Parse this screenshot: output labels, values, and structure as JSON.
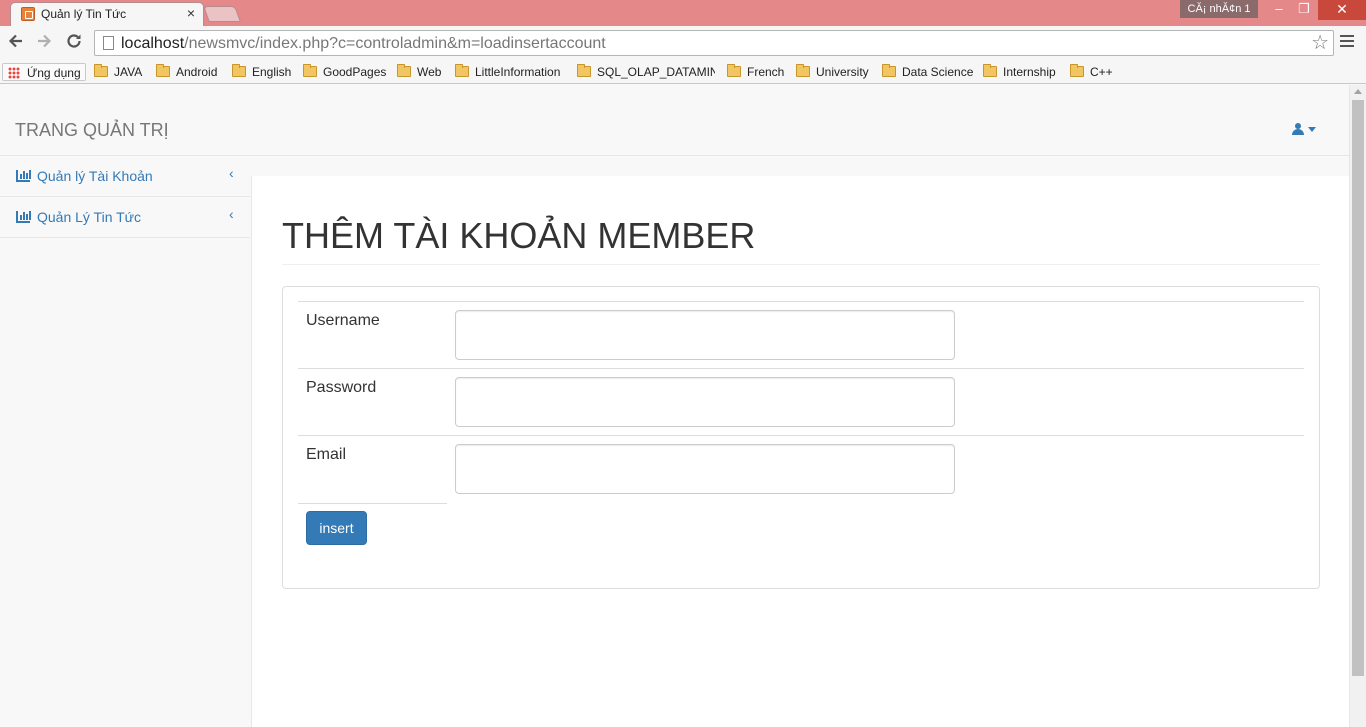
{
  "browser": {
    "tab_title": "Quản lý Tin Tức",
    "tab_close": "×",
    "profile_badge": "CĂ¡ nhĂ¢n 1",
    "window_controls": {
      "minimize": "–",
      "maximize": "❐",
      "close": "✕"
    },
    "url_host": "localhost",
    "url_path": "/newsmvc/index.php?c=controladmin&m=loadinsertaccount",
    "bookmarks": {
      "apps_label": "Ứng dụng",
      "folders": [
        "JAVA",
        "Android",
        "English",
        "GoodPages",
        "Web",
        "LittleInformation",
        "SQL_OLAP_DATAMIN",
        "French",
        "University",
        "Data Science",
        "Internship",
        "C++"
      ]
    }
  },
  "navbar": {
    "brand": "TRANG QUẢN TRỊ"
  },
  "sidebar": {
    "items": [
      {
        "label": "Quản lý Tài Khoản",
        "chevron": "‹"
      },
      {
        "label": "Quản Lý Tin Tức",
        "chevron": "‹"
      }
    ]
  },
  "main": {
    "title": "THÊM TÀI KHOẢN MEMBER",
    "form": {
      "fields": [
        {
          "label": "Username",
          "value": ""
        },
        {
          "label": "Password",
          "value": ""
        },
        {
          "label": "Email",
          "value": ""
        }
      ],
      "submit_label": "insert"
    }
  },
  "colors": {
    "accent": "#337ab7",
    "titlebar": "#e4888a"
  },
  "icons": [
    "close-icon",
    "back-arrow-icon",
    "forward-arrow-icon",
    "reload-icon",
    "page-icon",
    "star-icon",
    "menu-icon",
    "apps-grid-icon",
    "folder-icon",
    "user-icon",
    "caret-down-icon",
    "bar-chart-icon",
    "chevron-left-icon"
  ]
}
